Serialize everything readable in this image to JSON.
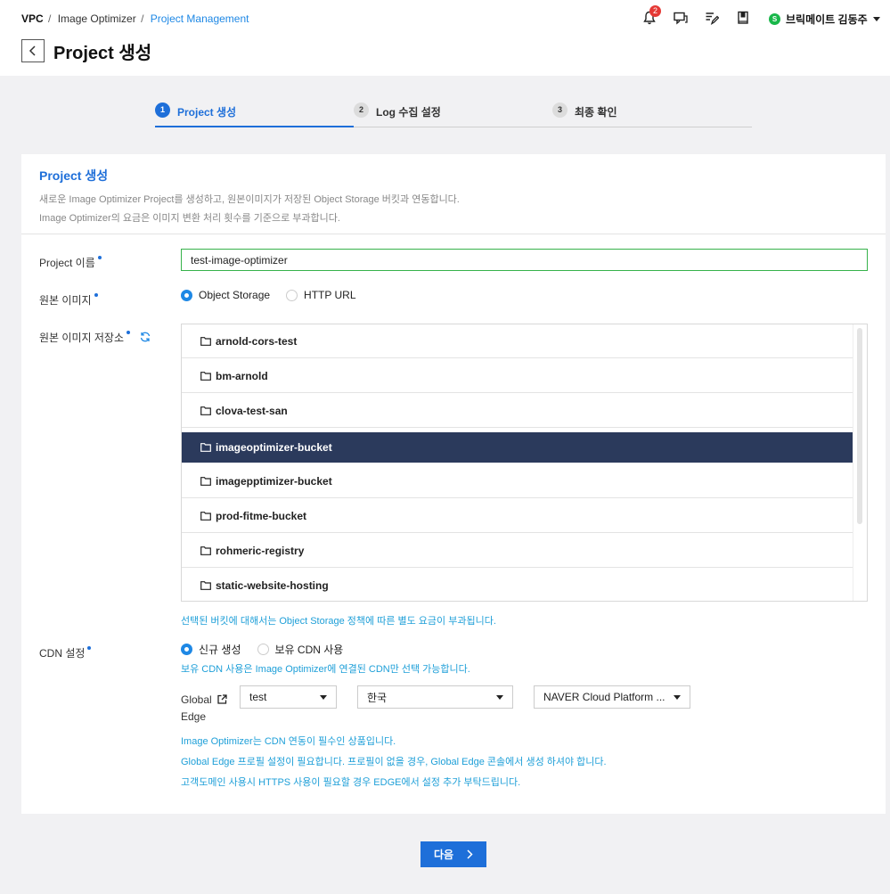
{
  "breadcrumb": {
    "root": "VPC",
    "parent": "Image Optimizer",
    "current": "Project Management"
  },
  "page": {
    "title": "Project 생성"
  },
  "header": {
    "notification_count": "2",
    "user_initial": "S",
    "user_name": "브릭메이트 김동주",
    "icons": [
      "bell-icon",
      "chat-icon",
      "edit-note-icon",
      "book-icon"
    ]
  },
  "steps": [
    {
      "number": "1",
      "label": "Project 생성",
      "active": true
    },
    {
      "number": "2",
      "label": "Log 수집 설정",
      "active": false
    },
    {
      "number": "3",
      "label": "최종 확인",
      "active": false
    }
  ],
  "card": {
    "title": "Project 생성",
    "desc1": "새로운 Image Optimizer Project를 생성하고, 원본이미지가 저장된 Object Storage 버킷과 연동합니다.",
    "desc2": "Image Optimizer의 요금은 이미지 변환 처리 횟수를 기준으로 부과합니다."
  },
  "form": {
    "project_name_label": "Project 이름",
    "project_name_value": "test-image-optimizer",
    "source_label": "원본 이미지",
    "source_options": [
      "Object Storage",
      "HTTP URL"
    ],
    "storage_label": "원본 이미지 저장소",
    "buckets": [
      "arnold-cors-test",
      "bm-arnold",
      "clova-test-san",
      "imageoptimizer-bucket",
      "imagepptimizer-bucket",
      "prod-fitme-bucket",
      "rohmeric-registry",
      "static-website-hosting"
    ],
    "selected_bucket": "imageoptimizer-bucket",
    "bucket_note": "선택된 버킷에 대해서는 Object Storage 정책에 따른 별도 요금이 부과됩니다.",
    "cdn_label": "CDN 설정",
    "cdn_options": [
      "신규 생성",
      "보유 CDN 사용"
    ],
    "cdn_note": "보유 CDN 사용은 Image Optimizer에 연결된 CDN만 선택 가능합니다.",
    "ge_label_line1": "Global",
    "ge_label_line2": "Edge",
    "selects": [
      "test",
      "한국",
      "NAVER Cloud Platform ..."
    ],
    "notes": [
      "Image Optimizer는 CDN 연동이 필수인 상품입니다.",
      "Global Edge 프로필 설정이 필요합니다. 프로필이 없을 경우, Global Edge 콘솔에서 생성 하셔야 합니다.",
      "고객도메인 사용시 HTTPS 사용이 필요할 경우 EDGE에서 설정 추가 부탁드립니다."
    ]
  },
  "buttons": {
    "next": "다음"
  },
  "colors": {
    "accent": "#1e6fd9",
    "selected_row": "#2b3a5c",
    "note": "#1e9fd8",
    "success": "#36b24a"
  }
}
